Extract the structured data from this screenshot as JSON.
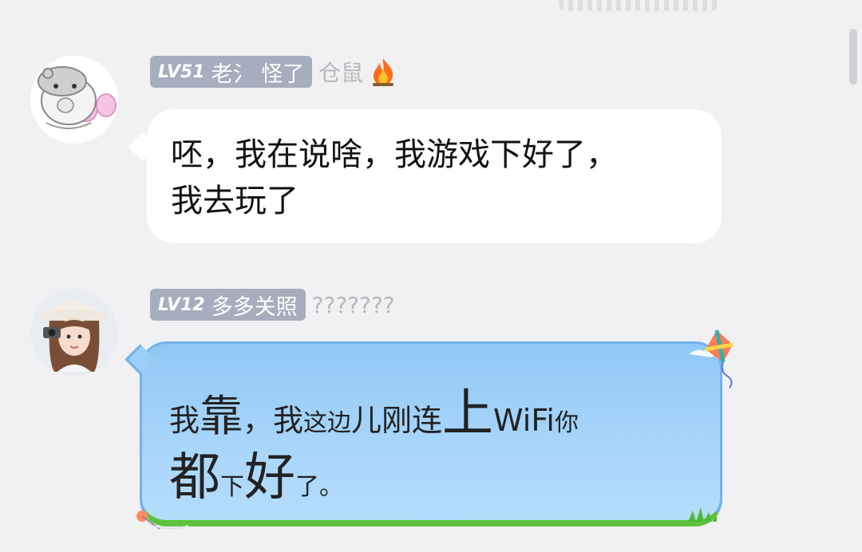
{
  "messages": [
    {
      "level": "LV51",
      "nickname": "老氵 怪了",
      "title": "仓鼠",
      "badge_icon": "fire-icon",
      "avatar_icon": "hamster-avatar-icon",
      "lines": [
        "呸，我在说啥，我游戏下好了，",
        "我去玩了"
      ]
    },
    {
      "level": "LV12",
      "nickname": "多多关照",
      "title": "???????",
      "avatar_icon": "girl-with-camera-avatar-icon",
      "bubble_theme": "kite-sky",
      "line1": [
        {
          "text": "我",
          "size": "s1"
        },
        {
          "text": "靠",
          "size": "s3"
        },
        {
          "text": "，我",
          "size": "s1"
        },
        {
          "text": "这边",
          "size": "s2"
        },
        {
          "text": "儿刚连",
          "size": "s1"
        },
        {
          "text": "上",
          "size": "s4"
        },
        {
          "text": "WiFi",
          "size": "s1"
        },
        {
          "text": "你",
          "size": "s2"
        }
      ],
      "line2": [
        {
          "text": "都",
          "size": "s4"
        },
        {
          "text": "下",
          "size": "s2"
        },
        {
          "text": "好",
          "size": "s4"
        },
        {
          "text": "了。",
          "size": "s2"
        }
      ]
    }
  ],
  "colors": {
    "background": "#f1f1f3",
    "tag": "#a7adbe",
    "bubble_white": "#ffffff",
    "bubble_blue": "#a9d6fb",
    "bubble_grass": "#5cc33a"
  }
}
